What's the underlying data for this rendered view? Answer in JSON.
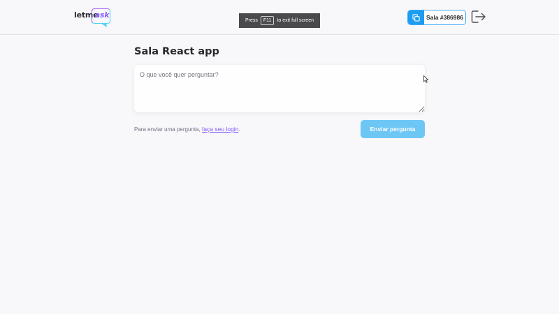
{
  "header": {
    "logo": {
      "part1": "letme",
      "part2": "ask"
    },
    "fullscreen_tip": {
      "before": "Press",
      "key": "F11",
      "after": "to exit full screen"
    },
    "room_code": {
      "label": "Sala #386986",
      "icon": "copy-icon"
    },
    "logout": {
      "icon": "logout-icon"
    }
  },
  "main": {
    "title": "Sala React app",
    "question_placeholder": "O que você quer perguntar?",
    "login_prompt": "Para enviar uma pergunta,",
    "login_link": "faça seu login",
    "login_suffix": ".",
    "submit_label": "Enviar pergunta"
  },
  "colors": {
    "background": "#f8f7fa",
    "accent_blue": "#1a9df2",
    "disabled_button": "#6ec6f5",
    "link_purple": "#835afd"
  }
}
